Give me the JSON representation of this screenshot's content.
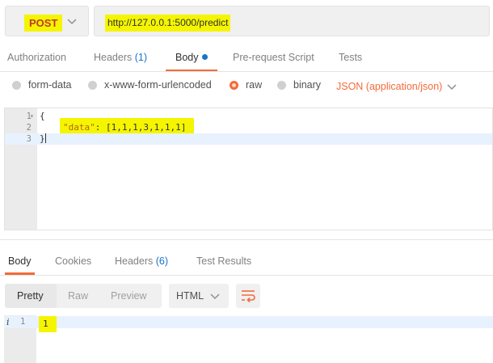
{
  "request": {
    "method": "POST",
    "url": "http://127.0.0.1:5000/predict"
  },
  "request_tabs": [
    {
      "label": "Authorization"
    },
    {
      "label": "Headers",
      "count": "(1)"
    },
    {
      "label": "Body",
      "active": true,
      "indicator": "dot"
    },
    {
      "label": "Pre-request Script"
    },
    {
      "label": "Tests"
    }
  ],
  "body_types": {
    "options": [
      "form-data",
      "x-www-form-urlencoded",
      "raw",
      "binary"
    ],
    "selected": "raw",
    "content_type": "JSON (application/json)"
  },
  "editor": {
    "lines": [
      {
        "num": "1",
        "fold": "▾",
        "text": "{"
      },
      {
        "num": "2",
        "key": "\"data\"",
        "text": ": [1,1,1,3,1,1,1]"
      },
      {
        "num": "3",
        "text": "}"
      }
    ]
  },
  "response_tabs": [
    {
      "label": "Body",
      "active": true
    },
    {
      "label": "Cookies"
    },
    {
      "label": "Headers",
      "count": "(6)"
    },
    {
      "label": "Test Results"
    }
  ],
  "response_toolbar": {
    "views": [
      "Pretty",
      "Raw",
      "Preview"
    ],
    "active_view": "Pretty",
    "format": "HTML",
    "wrap_icon": "wrap-lines-icon"
  },
  "response_body": {
    "info_marker": "i",
    "line_num": "1",
    "value": "1"
  },
  "colors": {
    "accent": "#f26b3a",
    "method": "#c0392b",
    "link": "#1a73c8",
    "highlight": "#f5f500"
  }
}
